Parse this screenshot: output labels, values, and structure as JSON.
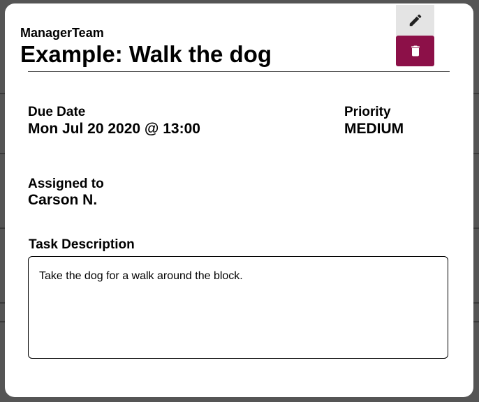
{
  "modal": {
    "team": "ManagerTeam",
    "title": "Example: Walk the dog"
  },
  "actions": {
    "edit_icon": "pencil-icon",
    "delete_icon": "trash-icon",
    "delete_color": "#8c1048"
  },
  "fields": {
    "due_date": {
      "label": "Due Date",
      "value": "Mon Jul 20 2020 @ 13:00"
    },
    "priority": {
      "label": "Priority",
      "value": "MEDIUM"
    },
    "assigned": {
      "label": "Assigned to",
      "value": "Carson N."
    }
  },
  "description": {
    "label": "Task Description",
    "text": "Take the dog for a walk around the block."
  }
}
